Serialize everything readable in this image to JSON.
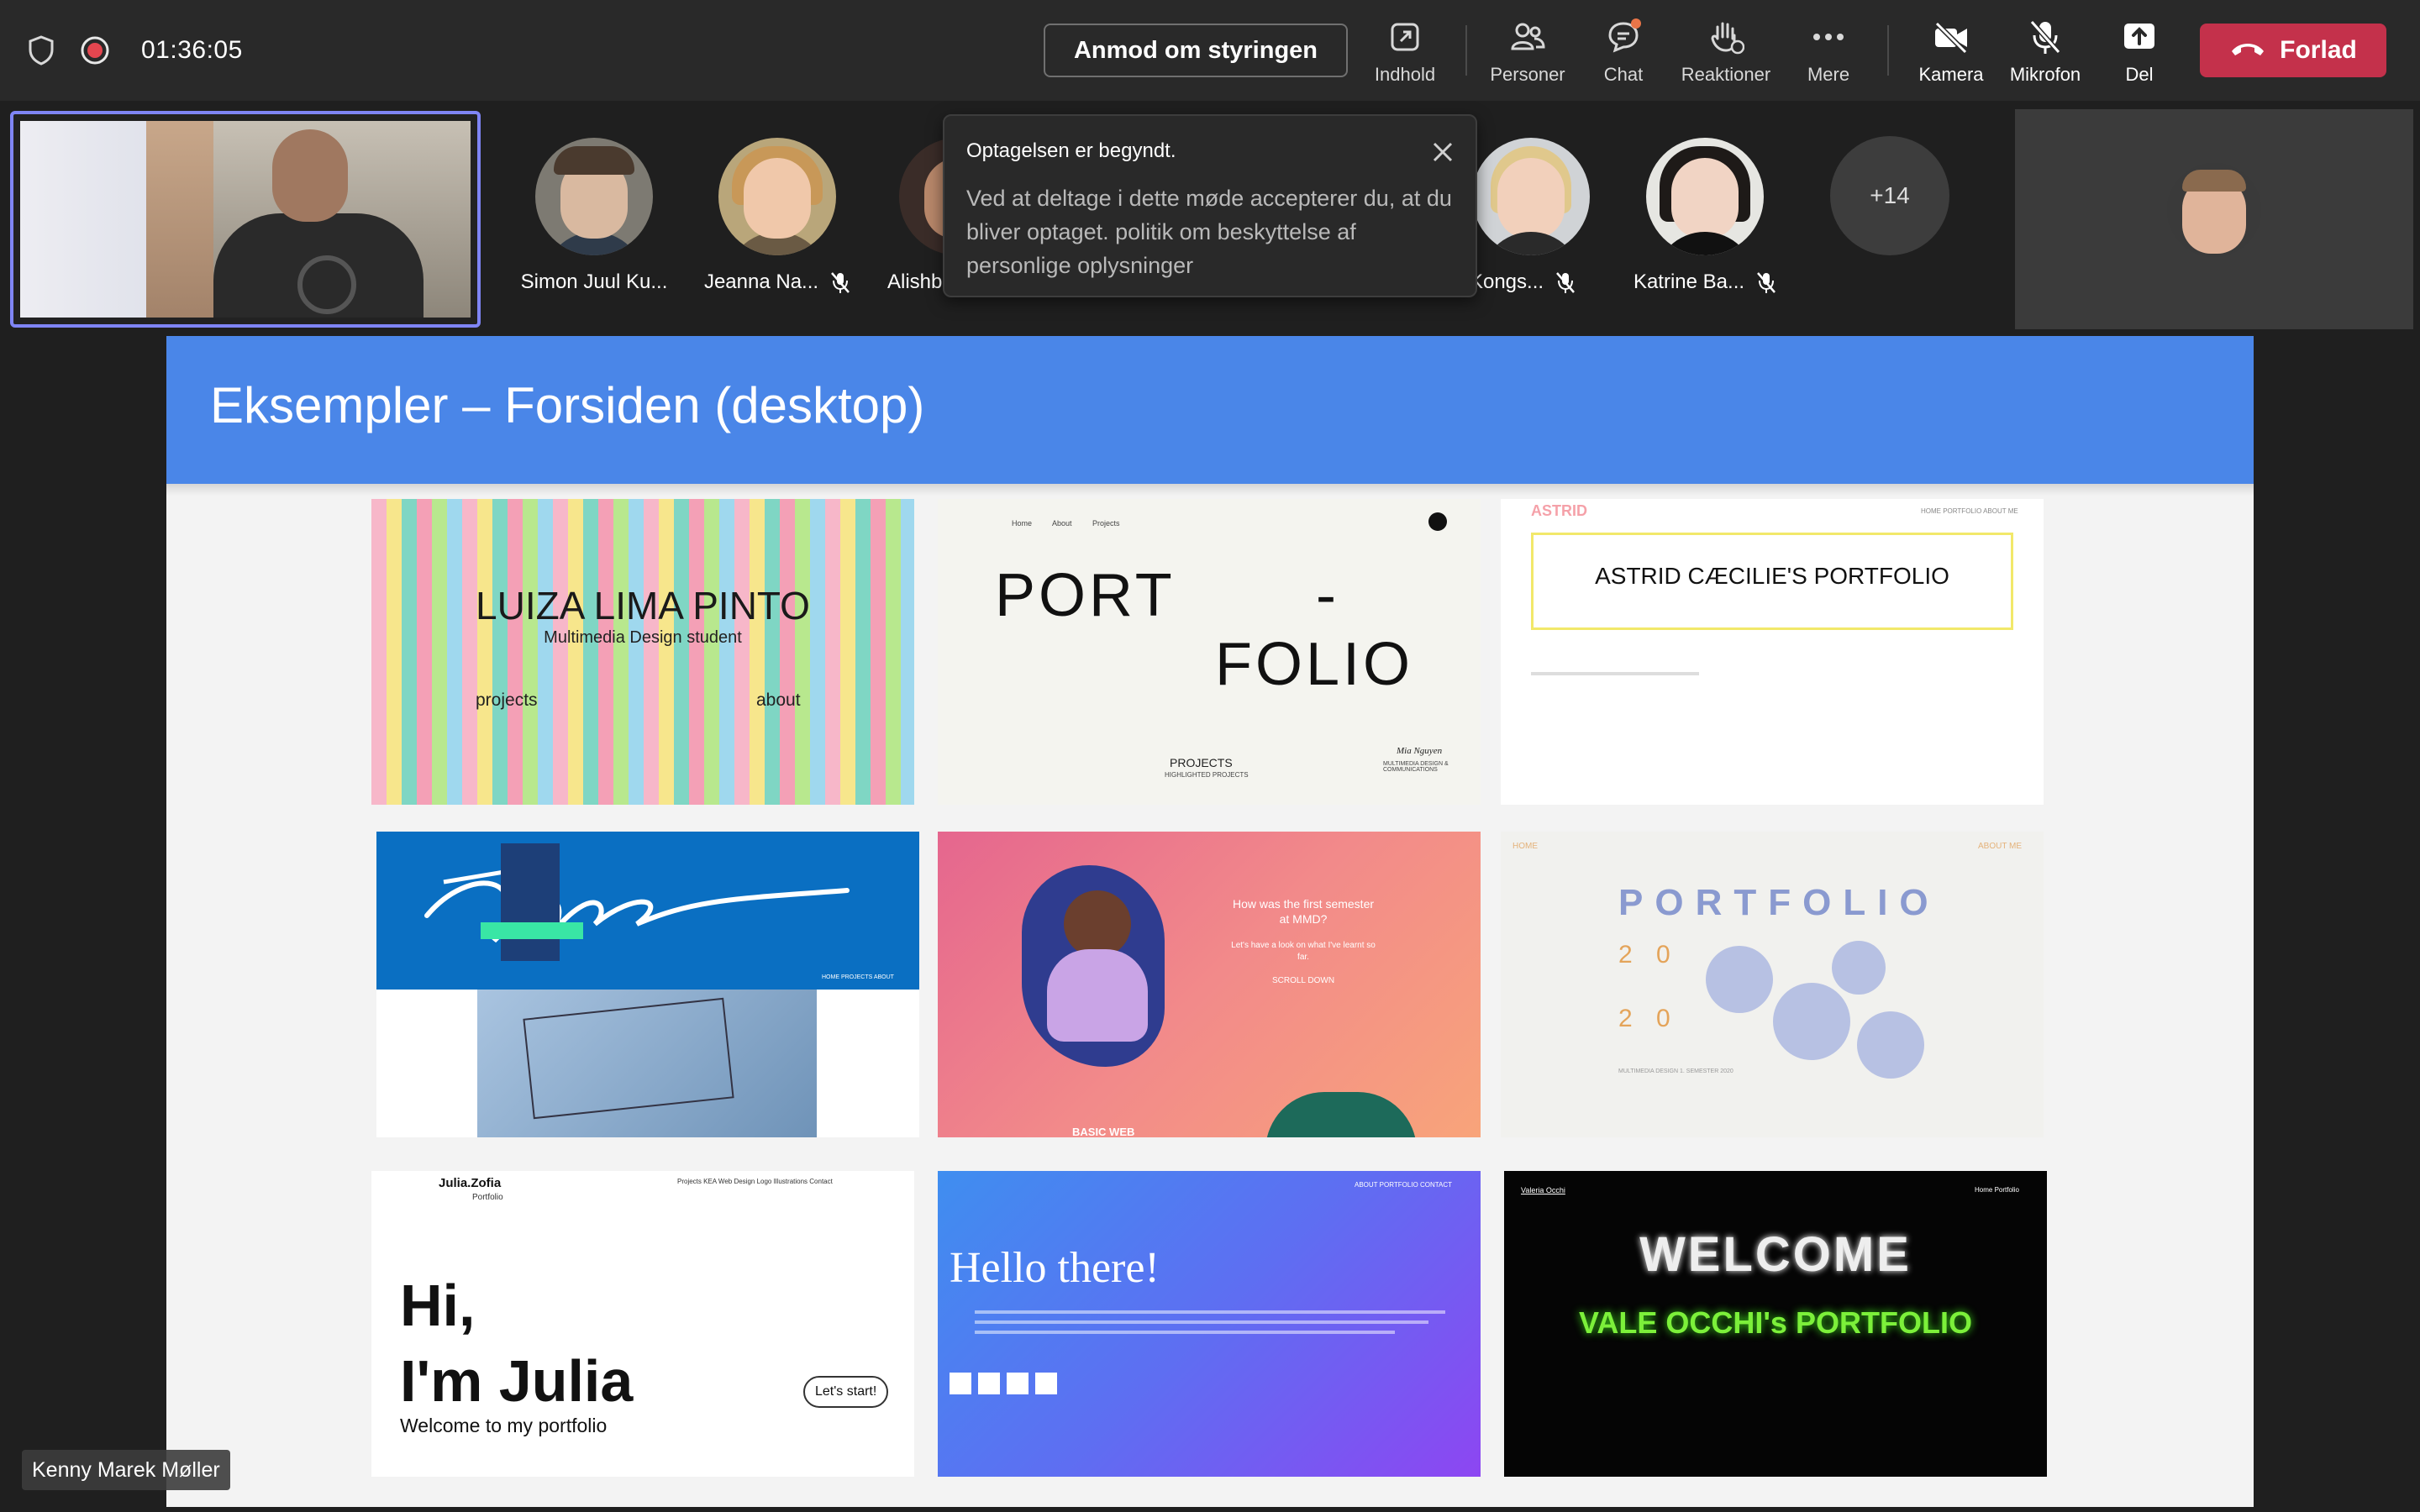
{
  "topbar": {
    "timer": "01:36:05",
    "request_control": "Anmod om styringen",
    "items": {
      "content": "Indhold",
      "people": "Personer",
      "chat": "Chat",
      "reactions": "Reaktioner",
      "more": "Mere",
      "camera": "Kamera",
      "mic": "Mikrofon",
      "share": "Del"
    },
    "leave": "Forlad"
  },
  "participants": [
    {
      "name": "Simon Juul Ku...",
      "muted": false
    },
    {
      "name": "Jeanna Na...",
      "muted": true
    },
    {
      "name": "Alishb",
      "muted": false
    },
    {
      "name": "Kongs...",
      "muted": true
    },
    {
      "name": "Katrine Ba...",
      "muted": true
    }
  ],
  "more_participants": "+14",
  "toast": {
    "title": "Optagelsen er begyndt.",
    "body": "Ved at deltage i dette møde accepterer du, at du bliver optaget. politik om beskyttelse af personlige oplysninger"
  },
  "slide": {
    "title": "Eksempler – Forsiden (desktop)",
    "header_color": "#4a86e8",
    "thumbs": {
      "t1": {
        "name": "LUIZA LIMA PINTO",
        "sub": "Multimedia Design student",
        "left": "projects",
        "right": "about"
      },
      "t2": {
        "line1": "PORT",
        "dash": "-",
        "line2": "FOLIO",
        "nav1": "Home",
        "nav2": "About",
        "nav3": "Projects",
        "footer1": "PROJECTS",
        "footer2": "HIGHLIGHTED PROJECTS",
        "sig": "Mia Nguyen",
        "sig2": "MULTIMEDIA DESIGN & COMMUNICATIONS"
      },
      "t3": {
        "brand": "ASTRID",
        "title": "ASTRID CÆCILIE'S PORTFOLIO",
        "nav": "HOME    PORTFOLIO    ABOUT ME"
      },
      "t4": {
        "nav": "HOME    PROJECTS    ABOUT"
      },
      "t5": {
        "q1": "How was the first semester",
        "q2": "at MMD?",
        "q3": "Let's have a look on what I've learnt so",
        "q4": "far.",
        "scroll": "SCROLL DOWN",
        "bottom": "BASIC WEB"
      },
      "t6": {
        "title": "PORTFOLIO",
        "y1": "2 0",
        "y2": "2 0",
        "home": "HOME",
        "about": "ABOUT ME",
        "caption": "MULTIMEDIA DESIGN 1. SEMESTER 2020"
      },
      "t7": {
        "brand": "Julia.Zofia",
        "brand2": "Portfolio",
        "nav": "Projects KEA   Web Design   Logo   Illustrations   Contact",
        "hi": "Hi,",
        "im": "I'm Julia",
        "welcome": "Welcome to my portfolio",
        "cta": "Let's start!"
      },
      "t8": {
        "title": "Hello there!",
        "nav": "ABOUT    PORTFOLIO    CONTACT"
      },
      "t9": {
        "brand": "Valeria Occhi",
        "nav": "Home    Portfolio",
        "welcome": "WELCOME",
        "sub": "VALE OCCHI's PORTFOLIO"
      }
    }
  },
  "presenter_label": "Kenny Marek Møller"
}
